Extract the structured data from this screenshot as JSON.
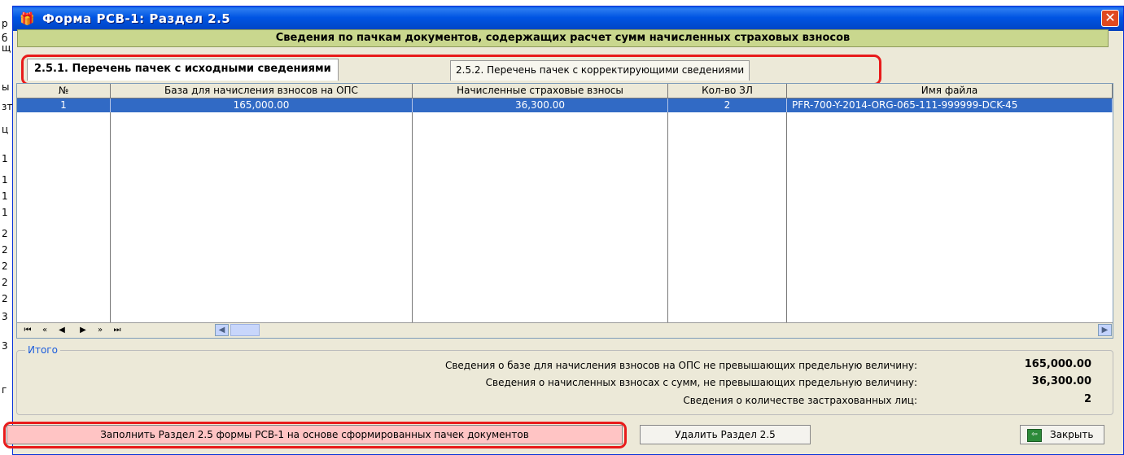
{
  "window": {
    "title": "Форма РСВ-1: Раздел 2.5",
    "close_glyph": "✕",
    "icon": "gift-app-icon"
  },
  "header": {
    "text": "Сведения по пачкам документов, содержащих расчет сумм начисленных страховых взносов"
  },
  "tabs": [
    {
      "label": "2.5.1. Перечень пачек с исходными сведениями",
      "active": true
    },
    {
      "label": "2.5.2. Перечень пачек с корректирующими сведениями",
      "active": false
    }
  ],
  "grid": {
    "columns": [
      "№",
      "База для начисления взносов на ОПС",
      "Начисленные страховые взносы",
      "Кол-во ЗЛ",
      "Имя файла"
    ],
    "rows": [
      [
        "1",
        "165,000.00",
        "36,300.00",
        "2",
        "PFR-700-Y-2014-ORG-065-111-999999-DCK-45"
      ]
    ],
    "nav": [
      "⏮",
      "«",
      "◀",
      "▶",
      "»",
      "⏭"
    ]
  },
  "totals": {
    "legend": "Итого",
    "items": [
      {
        "label": "Сведения о базе для начисления взносов на ОПС не превышающих предельную величину:",
        "value": "165,000.00"
      },
      {
        "label": "Сведения о начисленных взносах с сумм, не превышающих предельную величину:",
        "value": "36,300.00"
      },
      {
        "label": "Сведения о количестве застрахованных лиц:",
        "value": "2"
      }
    ]
  },
  "buttons": {
    "fill": "Заполнить Раздел 2.5 формы РСВ-1 на основе сформированных пачек документов",
    "delete": "Удалить Раздел 2.5",
    "close": "Закрыть"
  },
  "background_glyphs": [
    "р",
    "б",
    "щ",
    "ы",
    "зт",
    "ц",
    "1",
    "1",
    "1",
    "1",
    "2",
    "2",
    "2",
    "2",
    "2",
    "3",
    "3",
    "г"
  ],
  "colors": {
    "selection": "#316ac5",
    "header_bar": "#c9d78e",
    "highlight": "#e81b1b",
    "fill_button": "#ffc4c4"
  }
}
